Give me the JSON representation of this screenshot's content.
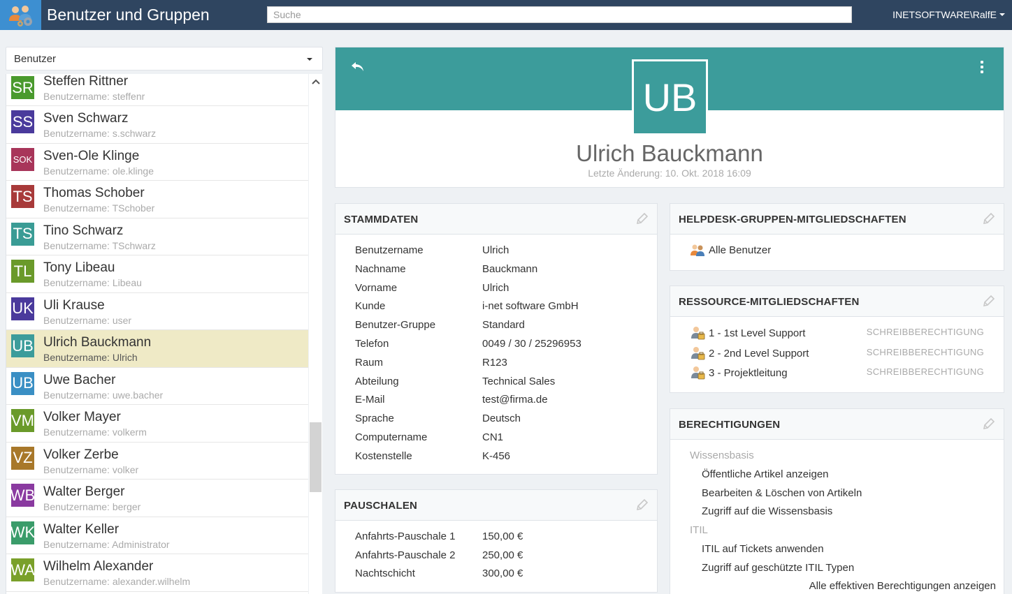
{
  "app": {
    "title": "Benutzer und Gruppen",
    "logo_icon": "users-gear-icon"
  },
  "search": {
    "placeholder": "Suche",
    "value": ""
  },
  "user_menu": {
    "label": "INETSOFTWARE\\RalfE"
  },
  "type_select": {
    "value": "Benutzer"
  },
  "users": [
    {
      "initials": "SR",
      "name": "Steffen Rittner",
      "login_prefix": "Benutzername:",
      "login": "steffenr",
      "color": "#4a9a2e"
    },
    {
      "initials": "SS",
      "name": "Sven Schwarz",
      "login_prefix": "Benutzername:",
      "login": "s.schwarz",
      "color": "#4a3a9c"
    },
    {
      "initials": "SOK",
      "name": "Sven-Ole Klinge",
      "login_prefix": "Benutzername:",
      "login": "ole.klinge",
      "color": "#a8355a"
    },
    {
      "initials": "TS",
      "name": "Thomas Schober",
      "login_prefix": "Benutzername:",
      "login": "TSchober",
      "color": "#a83a3a"
    },
    {
      "initials": "TS",
      "name": "Tino Schwarz",
      "login_prefix": "Benutzername:",
      "login": "TSchwarz",
      "color": "#3a9c95"
    },
    {
      "initials": "TL",
      "name": "Tony Libeau",
      "login_prefix": "Benutzername:",
      "login": "Libeau",
      "color": "#6a9a2a"
    },
    {
      "initials": "UK",
      "name": "Uli Krause",
      "login_prefix": "Benutzername:",
      "login": "user",
      "color": "#4a3a9c"
    },
    {
      "initials": "UB",
      "name": "Ulrich Bauckmann",
      "login_prefix": "Benutzername:",
      "login": "Ulrich",
      "color": "#3c9c9b",
      "selected": true
    },
    {
      "initials": "UB",
      "name": "Uwe Bacher",
      "login_prefix": "Benutzername:",
      "login": "uwe.bacher",
      "color": "#3a8fc4"
    },
    {
      "initials": "VM",
      "name": "Volker Mayer",
      "login_prefix": "Benutzername:",
      "login": "volkerm",
      "color": "#6a9a2a"
    },
    {
      "initials": "VZ",
      "name": "Volker Zerbe",
      "login_prefix": "Benutzername:",
      "login": "volker",
      "color": "#a8782a"
    },
    {
      "initials": "WB",
      "name": "Walter Berger",
      "login_prefix": "Benutzername:",
      "login": "berger",
      "color": "#8a3aa0"
    },
    {
      "initials": "WK",
      "name": "Walter Keller",
      "login_prefix": "Benutzername:",
      "login": "Administrator",
      "color": "#3a9c6a"
    },
    {
      "initials": "WA",
      "name": "Wilhelm Alexander",
      "login_prefix": "Benutzername:",
      "login": "alexander.wilhelm",
      "color": "#7aa02a"
    }
  ],
  "detail": {
    "initials": "UB",
    "name": "Ulrich Bauckmann",
    "modified": "Letzte Änderung: 10. Okt. 2018 16:09",
    "accent_color": "#3c9c9b"
  },
  "stammdaten": {
    "title": "STAMMDATEN",
    "rows": [
      {
        "label": "Benutzername",
        "value": "Ulrich"
      },
      {
        "label": "Nachname",
        "value": "Bauckmann"
      },
      {
        "label": "Vorname",
        "value": "Ulrich"
      },
      {
        "label": "Kunde",
        "value": "i-net software GmbH"
      },
      {
        "label": "Benutzer-Gruppe",
        "value": "Standard"
      },
      {
        "label": "Telefon",
        "value": "0049 / 30 / 25296953"
      },
      {
        "label": "Raum",
        "value": "R123"
      },
      {
        "label": "Abteilung",
        "value": "Technical Sales"
      },
      {
        "label": "E-Mail",
        "value": "test@firma.de"
      },
      {
        "label": "Sprache",
        "value": "Deutsch"
      },
      {
        "label": "Computername",
        "value": "CN1"
      },
      {
        "label": "Kostenstelle",
        "value": "K-456"
      }
    ]
  },
  "pauschalen": {
    "title": "PAUSCHALEN",
    "rows": [
      {
        "label": "Anfahrts-Pauschale 1",
        "value": "150,00 €"
      },
      {
        "label": "Anfahrts-Pauschale 2",
        "value": "250,00 €"
      },
      {
        "label": "Nachtschicht",
        "value": "300,00 €"
      }
    ]
  },
  "helpdesk_groups": {
    "title": "HELPDESK-GRUPPEN-MITGLIEDSCHAFTEN",
    "items": [
      {
        "label": "Alle Benutzer"
      }
    ]
  },
  "resource_memberships": {
    "title": "RESSOURCE-MITGLIEDSCHAFTEN",
    "items": [
      {
        "label": "1 - 1st Level Support",
        "permission": "SCHREIBBERECHTIGUNG"
      },
      {
        "label": "2 - 2nd Level Support",
        "permission": "SCHREIBBERECHTIGUNG"
      },
      {
        "label": "3 - Projektleitung",
        "permission": "SCHREIBBERECHTIGUNG"
      }
    ]
  },
  "permissions": {
    "title": "BERECHTIGUNGEN",
    "sections": [
      {
        "name": "Wissensbasis",
        "items": [
          "Öffentliche Artikel anzeigen",
          "Bearbeiten & Löschen von Artikeln",
          "Zugriff auf die Wissensbasis"
        ]
      },
      {
        "name": "ITIL",
        "items": [
          "ITIL auf Tickets anwenden",
          "Zugriff auf geschützte ITIL Typen"
        ]
      }
    ],
    "show_all": "Alle effektiven Berechtigungen anzeigen"
  }
}
